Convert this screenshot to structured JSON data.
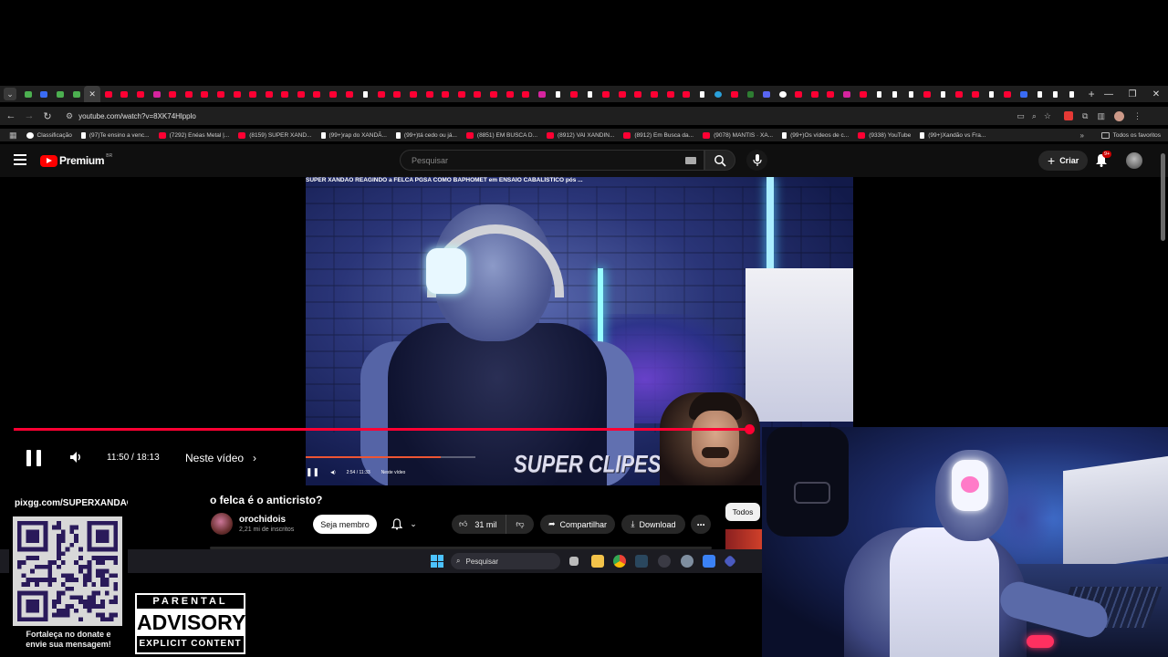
{
  "browser": {
    "tab_favicons": [
      "gm",
      "bl",
      "gm",
      "gm",
      "active",
      "yt",
      "yt",
      "yt",
      "ig",
      "yt",
      "yt",
      "yt",
      "yt",
      "yt",
      "yt",
      "yt",
      "yt",
      "yt",
      "yt",
      "yt",
      "yt",
      "tt",
      "yt",
      "yt",
      "yt",
      "yt",
      "yt",
      "yt",
      "yt",
      "yt",
      "yt",
      "yt",
      "ig",
      "tt",
      "yt",
      "tt",
      "yt",
      "yt",
      "yt",
      "yt",
      "yt",
      "yt",
      "tt",
      "tg",
      "yt",
      "ac",
      "dc",
      "gg",
      "yt",
      "yt",
      "yt",
      "ig",
      "yt",
      "tt",
      "tt",
      "tt",
      "yt",
      "tt",
      "yt",
      "yt",
      "tt",
      "yt",
      "bl",
      "tt",
      "tt",
      "tt"
    ],
    "new_tab": "+",
    "url": "youtube.com/watch?v=8XK74Hlpplo",
    "bookmarks": [
      {
        "icon": "gg",
        "label": "Classificação"
      },
      {
        "icon": "tt",
        "label": "(97)Te ensino a venc..."
      },
      {
        "icon": "yt",
        "label": "(7292) Enéas Metal |..."
      },
      {
        "icon": "yt",
        "label": "(8159) SUPER XAND..."
      },
      {
        "icon": "tt",
        "label": "(99+)rap do XANDÃ..."
      },
      {
        "icon": "tt",
        "label": "(99+)tá cedo ou já..."
      },
      {
        "icon": "yt",
        "label": "(8851) EM BUSCA D..."
      },
      {
        "icon": "yt",
        "label": "(8912) VAI XANDIN..."
      },
      {
        "icon": "yt",
        "label": "(8912) Em Busca da..."
      },
      {
        "icon": "yt",
        "label": "(9078) MANTIS · XA..."
      },
      {
        "icon": "tt",
        "label": "(99+)Os vídeos de c..."
      },
      {
        "icon": "yt",
        "label": "(9338) YouTube"
      },
      {
        "icon": "tt",
        "label": "(99+)Xandão vs Fra..."
      }
    ],
    "all_bookmarks": "Todos os favoritos"
  },
  "youtube": {
    "logo_word": "Premium",
    "logo_region": "BR",
    "search_placeholder": "Pesquisar",
    "create_label": "Criar",
    "notif_badge": "9+"
  },
  "player": {
    "embedded_title": "SUPER XANDÃO REAGINDO a FELCA PGSA COMO BAPHOMET em ENSAIO CABALÍSTICO pós ...",
    "embedded_time": "2:54 / 11:33",
    "embedded_chapter": "Neste vídeo",
    "watermark": "SUPER CLIPES",
    "progress_fraction": 0.645,
    "time": "11:50 / 18:13",
    "chapter": "Neste vídeo"
  },
  "video": {
    "title": "o felca é o anticristo?",
    "channel": "orochidois",
    "subscribers": "2,21 mi de inscritos",
    "join_label": "Seja membro",
    "likes": "31 mil",
    "share_label": "Compartilhar",
    "download_label": "Download",
    "chip_all": "Todos"
  },
  "taskbar": {
    "search_label": "Pesquisar"
  },
  "overlay": {
    "donate_url": "pixgg.com/SUPERXANDAO",
    "donate_msg_1": "Fortaleça no donate e",
    "donate_msg_2": "envie sua mensagem!",
    "advisory_top": "PARENTAL",
    "advisory_mid": "ADVISORY",
    "advisory_bot": "EXPLICIT CONTENT"
  },
  "colors": {
    "accent_red": "#ff0033",
    "player_bg": "#0f0f0f",
    "pill_bg": "#272727"
  }
}
